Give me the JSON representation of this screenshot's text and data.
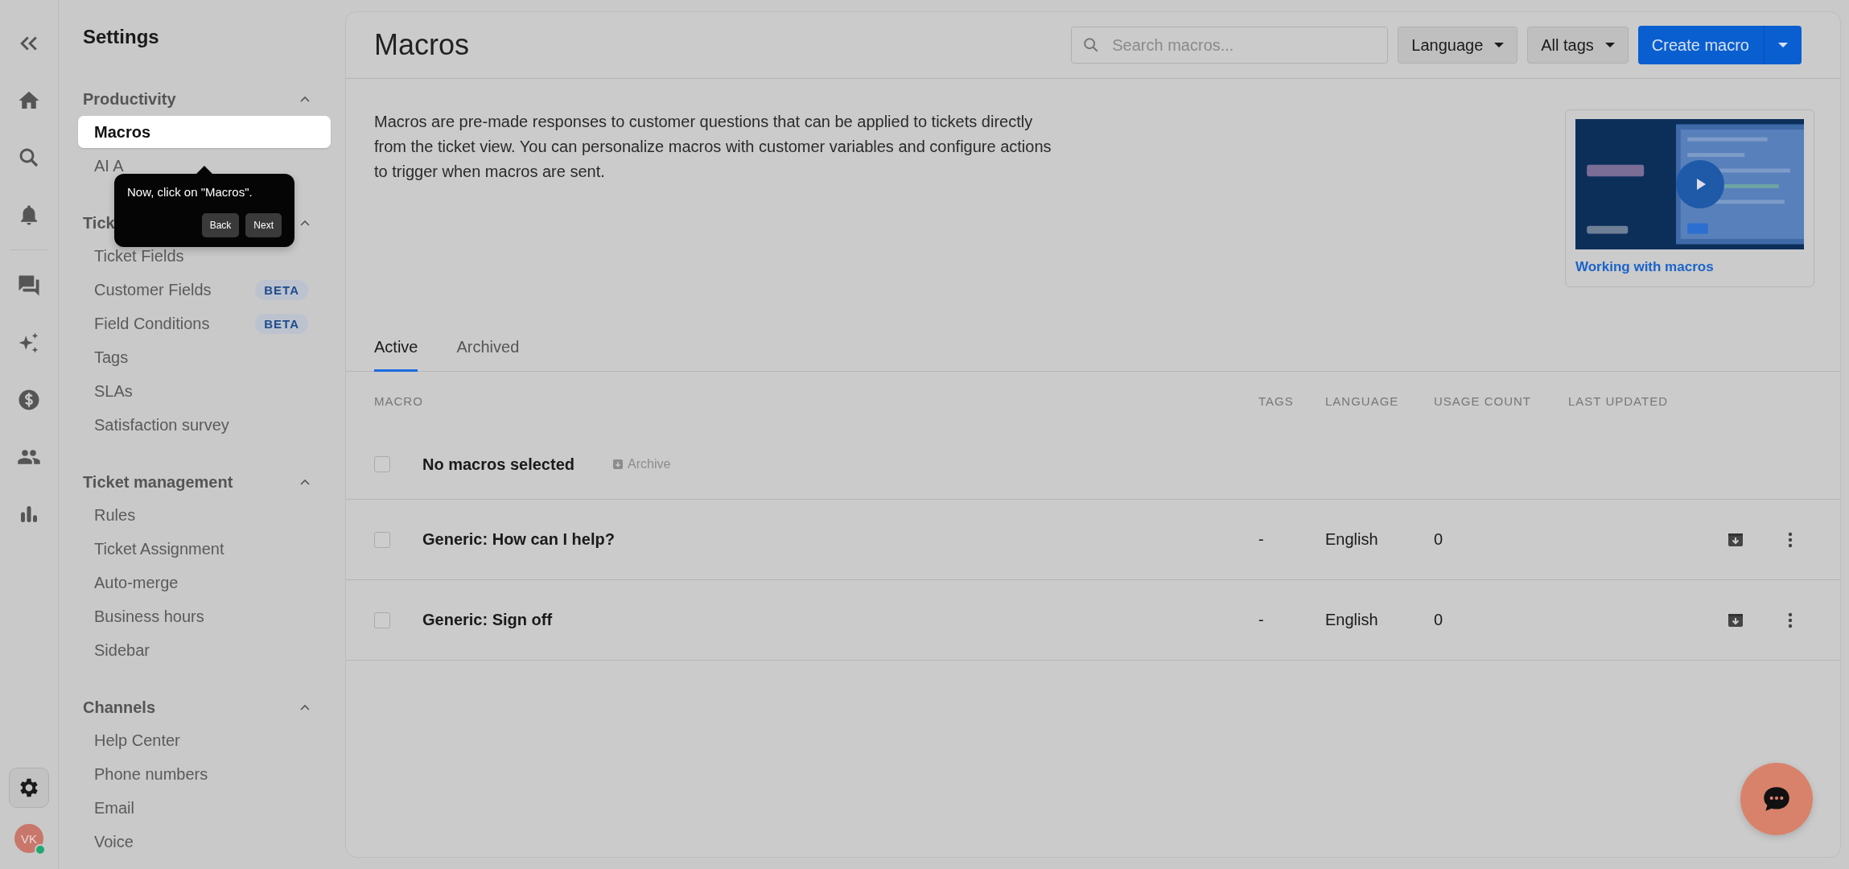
{
  "nav_rail": [
    {
      "kind": "collapse",
      "selected": false
    },
    {
      "kind": "home",
      "selected": false
    },
    {
      "kind": "search",
      "selected": false
    },
    {
      "kind": "bell",
      "selected": false
    },
    {
      "kind": "chat",
      "selected": false
    },
    {
      "kind": "sparkle",
      "selected": false
    },
    {
      "kind": "dollar",
      "selected": false
    },
    {
      "kind": "people",
      "selected": false
    },
    {
      "kind": "chart",
      "selected": false
    },
    {
      "kind": "gear",
      "selected": true
    }
  ],
  "avatar": {
    "initials": "VK",
    "online": true
  },
  "sidebar": {
    "title": "Settings",
    "sections": [
      {
        "heading": "Productivity",
        "expanded": true,
        "items": [
          {
            "label": "Macros",
            "selected": true
          },
          {
            "label": "AI A",
            "selected": false
          }
        ]
      },
      {
        "heading": "Tick",
        "expanded": true,
        "items": [
          {
            "label": "Ticket Fields",
            "selected": false
          },
          {
            "label": "Customer Fields",
            "selected": false,
            "badge": "BETA"
          },
          {
            "label": "Field Conditions",
            "selected": false,
            "badge": "BETA"
          },
          {
            "label": "Tags",
            "selected": false
          },
          {
            "label": "SLAs",
            "selected": false
          },
          {
            "label": "Satisfaction survey",
            "selected": false
          }
        ]
      },
      {
        "heading": "Ticket management",
        "expanded": true,
        "items": [
          {
            "label": "Rules",
            "selected": false
          },
          {
            "label": "Ticket Assignment",
            "selected": false
          },
          {
            "label": "Auto-merge",
            "selected": false
          },
          {
            "label": "Business hours",
            "selected": false
          },
          {
            "label": "Sidebar",
            "selected": false
          }
        ]
      },
      {
        "heading": "Channels",
        "expanded": true,
        "items": [
          {
            "label": "Help Center",
            "selected": false
          },
          {
            "label": "Phone numbers",
            "selected": false
          },
          {
            "label": "Email",
            "selected": false
          },
          {
            "label": "Voice",
            "selected": false
          }
        ]
      }
    ]
  },
  "tour_tooltip": {
    "text": "Now, click on \"Macros\".",
    "buttons": [
      "Back",
      "Next"
    ]
  },
  "header": {
    "title": "Macros",
    "search": {
      "placeholder": "Search macros..."
    },
    "filters": [
      "Language",
      "All tags"
    ],
    "primary_button": "Create macro"
  },
  "description": "Macros are pre-made responses to customer questions that can be applied to tickets directly from the ticket view. You can personalize macros with customer variables and configure actions to trigger when macros are sent.",
  "video_card": {
    "kind": "picture",
    "link": "Working with macros"
  },
  "tabs": [
    {
      "label": "Active",
      "selected": true
    },
    {
      "label": "Archived",
      "selected": false
    }
  ],
  "table": {
    "columns": [
      "MACRO",
      "TAGS",
      "LANGUAGE",
      "USAGE COUNT",
      "LAST UPDATED"
    ],
    "selection_bar": {
      "checked": false,
      "text": "No macros selected",
      "action": "Archive",
      "action_disabled": true
    },
    "rows": [
      {
        "checked": false,
        "name": "Generic: How can I help?",
        "tags": "-",
        "language": "English",
        "usage_count": "0"
      },
      {
        "checked": false,
        "name": "Generic: Sign off",
        "tags": "-",
        "language": "English",
        "usage_count": "0"
      }
    ]
  }
}
